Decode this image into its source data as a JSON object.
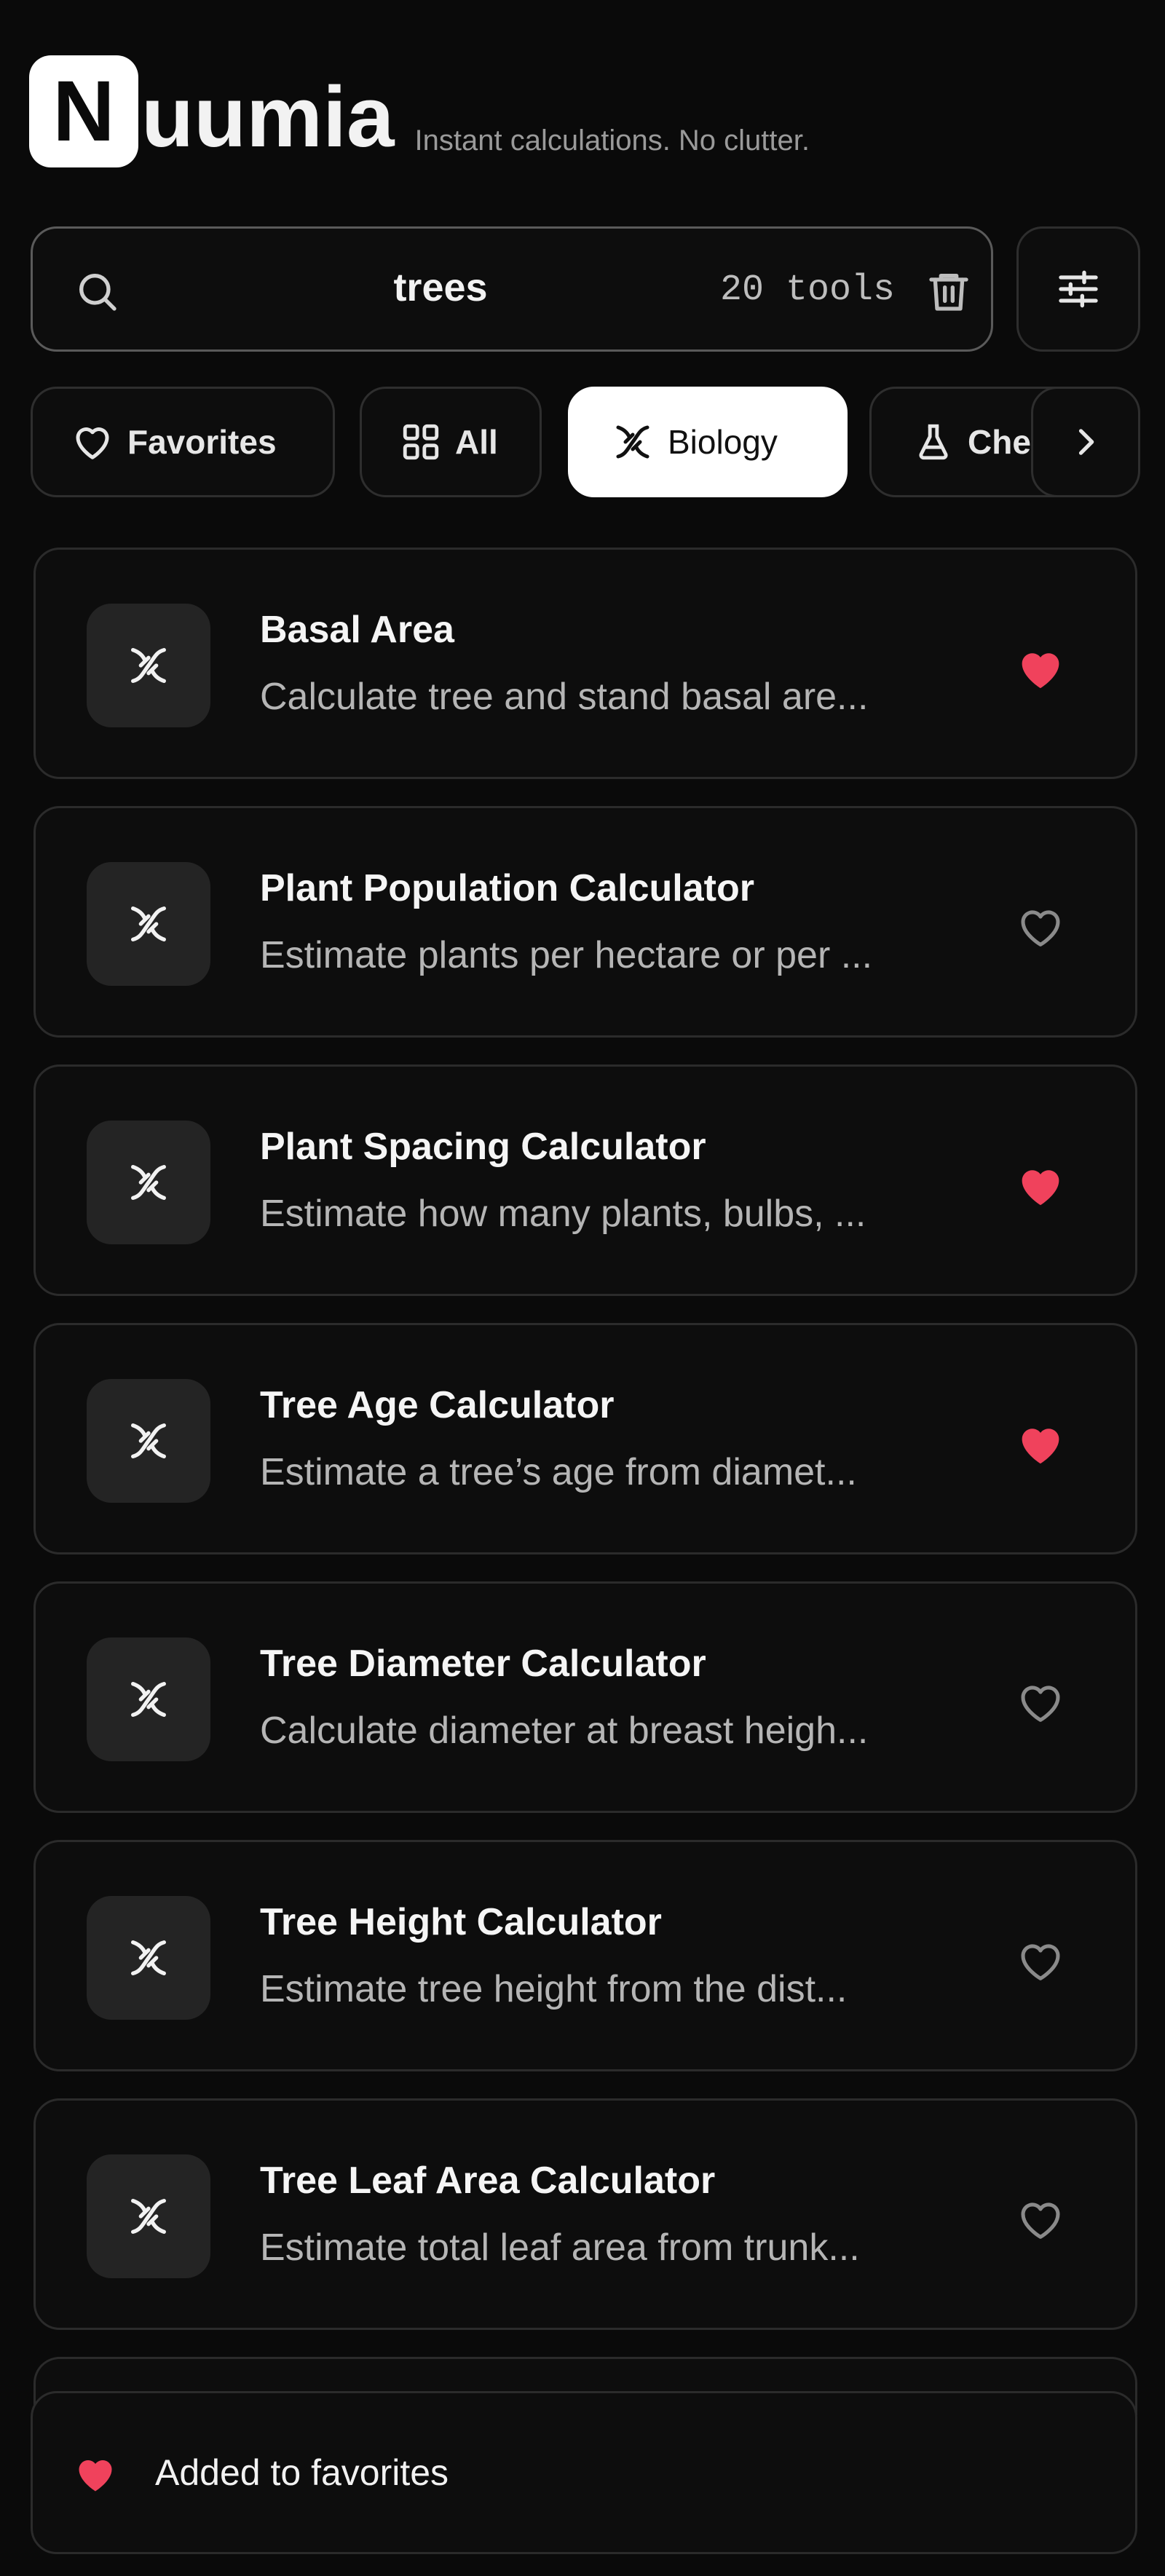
{
  "app": {
    "logo_letter": "N",
    "logo_rest": "uumia",
    "tagline": "Instant calculations. No clutter."
  },
  "search": {
    "value": "trees",
    "count": "20 tools",
    "icon": "search-icon",
    "clear_icon": "trash-icon"
  },
  "filter_button": {
    "icon": "sliders-icon"
  },
  "chips": [
    {
      "label": "Favorites",
      "icon": "heart-outline-icon",
      "active": false
    },
    {
      "label": "All",
      "icon": "grid-icon",
      "active": false
    },
    {
      "label": "Biology",
      "icon": "dna-icon",
      "active": true
    },
    {
      "label": "Che",
      "icon": "flask-icon",
      "active": false
    }
  ],
  "chips_next_icon": "chevron-right-icon",
  "tools": [
    {
      "title": "Basal Area",
      "description": "Calculate tree and stand basal are...",
      "favorited": true
    },
    {
      "title": "Plant Population Calculator",
      "description": "Estimate plants per hectare or per ...",
      "favorited": false
    },
    {
      "title": "Plant Spacing Calculator",
      "description": "Estimate how many plants, bulbs, ...",
      "favorited": true
    },
    {
      "title": "Tree Age Calculator",
      "description": "Estimate a tree’s age from diamet...",
      "favorited": true
    },
    {
      "title": "Tree Diameter Calculator",
      "description": "Calculate diameter at breast heigh...",
      "favorited": false
    },
    {
      "title": "Tree Height Calculator",
      "description": "Estimate tree height from the dist...",
      "favorited": false
    },
    {
      "title": "Tree Leaf Area Calculator",
      "description": "Estimate total leaf area from trunk...",
      "favorited": false
    }
  ],
  "toast": {
    "message": "Added to favorites"
  },
  "colors": {
    "background": "#0a0a0a",
    "card": "#0d0d0d",
    "favorite_red": "#f0425c",
    "muted_text": "#b5b5b5"
  }
}
